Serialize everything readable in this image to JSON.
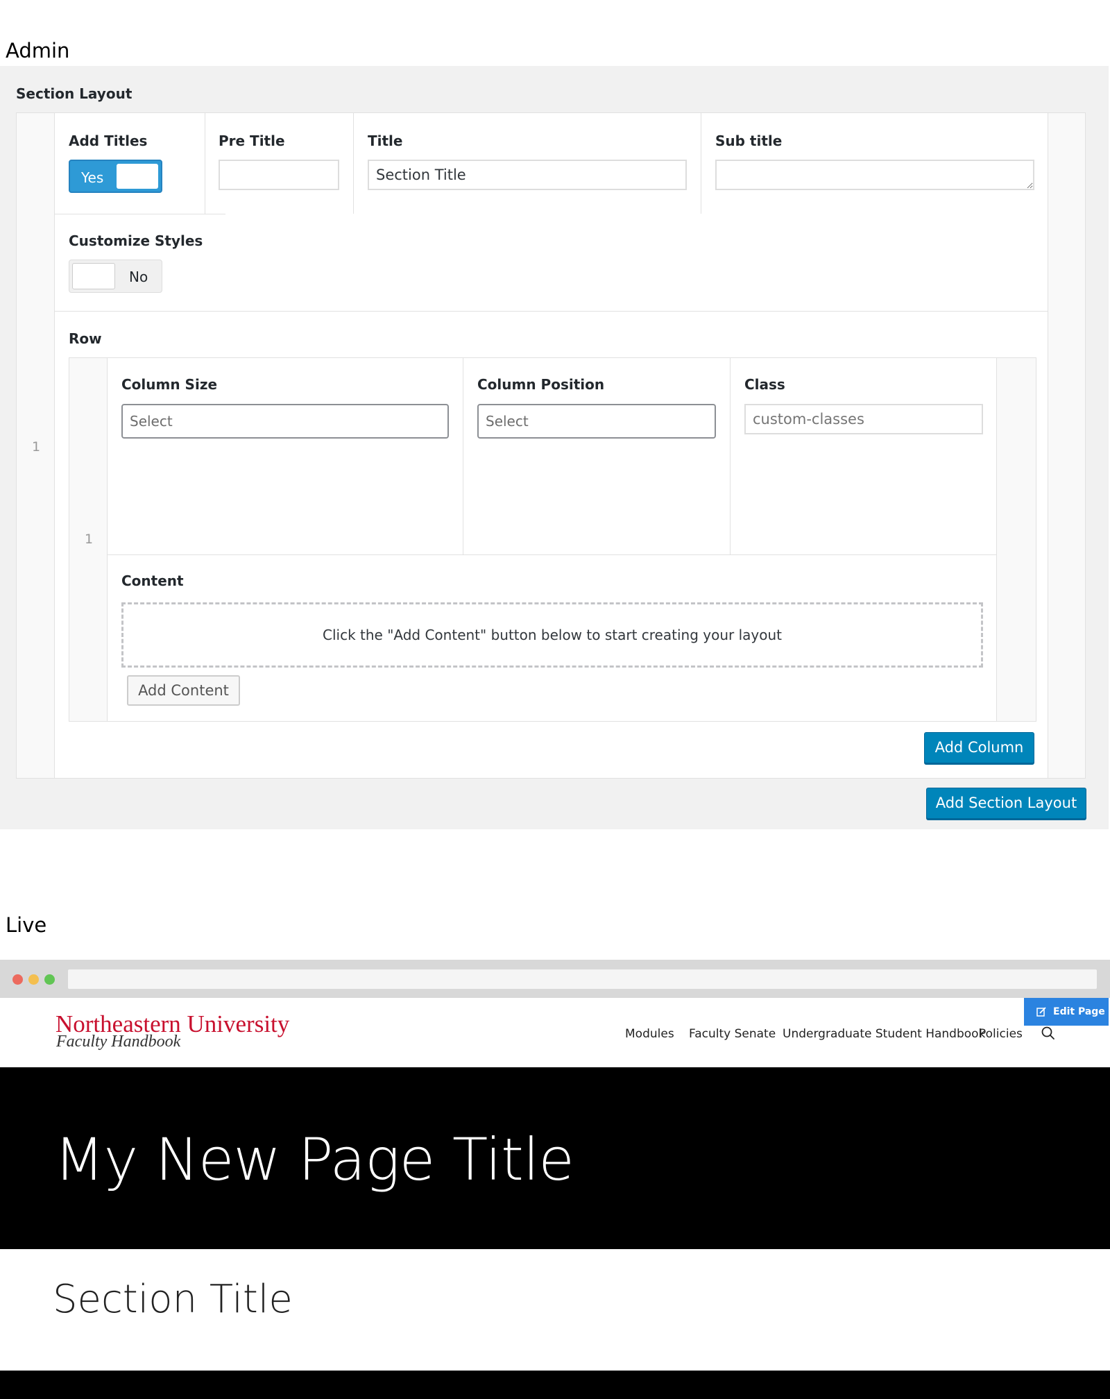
{
  "headings": {
    "admin": "Admin",
    "live": "Live"
  },
  "admin": {
    "panel_title": "Section Layout",
    "outer_row_number": "1",
    "add_titles": {
      "label": "Add Titles",
      "toggle_text": "Yes",
      "enabled": true
    },
    "pre_title": {
      "label": "Pre Title",
      "value": ""
    },
    "title": {
      "label": "Title",
      "value": "Section Title"
    },
    "sub_title": {
      "label": "Sub title",
      "value": ""
    },
    "customize_styles": {
      "label": "Customize Styles",
      "toggle_text": "No",
      "enabled": false
    },
    "row": {
      "label": "Row",
      "row_number": "1",
      "column_size": {
        "label": "Column Size",
        "value": "Select"
      },
      "column_position": {
        "label": "Column Position",
        "value": "Select"
      },
      "class": {
        "label": "Class",
        "placeholder": "custom-classes"
      },
      "content": {
        "label": "Content",
        "empty_message": "Click the \"Add Content\" button below to start creating your layout"
      },
      "add_content_button": "Add Content"
    },
    "add_column_button": "Add Column",
    "add_section_layout_button": "Add Section Layout"
  },
  "live": {
    "logo": {
      "line1": "Northeastern University",
      "line2": "Faculty Handbook"
    },
    "nav": [
      "Modules",
      "Faculty Senate",
      "Undergraduate Student Handbook",
      "Policies"
    ],
    "edit_page_button": "Edit Page",
    "hero_title": "My New Page Title",
    "section_title": "Section Title"
  },
  "colors": {
    "accent_blue": "#0085ba",
    "toggle_blue": "#2e9ad6",
    "edit_blue": "#2b83e0",
    "brand_red": "#c8102e",
    "mac_red": "#ec6a5e",
    "mac_yellow": "#f4bf4f",
    "mac_green": "#61c554"
  }
}
